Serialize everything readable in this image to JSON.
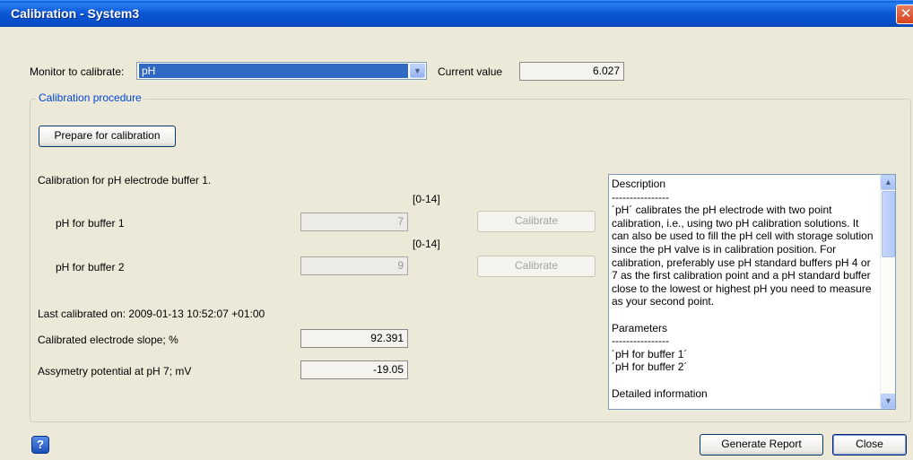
{
  "window": {
    "title": "Calibration - System3",
    "close_glyph": "✕"
  },
  "monitor": {
    "label": "Monitor to calibrate:",
    "selected": "pH",
    "current_value_label": "Current value",
    "current_value": "6.027"
  },
  "procedure": {
    "legend": "Calibration procedure",
    "prepare_label": "Prepare for calibration",
    "buffer_heading": "Calibration for pH  electrode buffer 1.",
    "buffers": [
      {
        "label": "pH for buffer 1",
        "value": "7",
        "range": "[0-14]",
        "calibrate_label": "Calibrate"
      },
      {
        "label": "pH for buffer 2",
        "value": "9",
        "range": "[0-14]",
        "calibrate_label": "Calibrate"
      }
    ],
    "last_calibrated": "Last calibrated on: 2009-01-13 10:52:07 +01:00",
    "slope_label": "Calibrated electrode slope; %",
    "slope_value": "92.391",
    "asym_label": "Assymetry potential at pH 7; mV",
    "asym_value": "-19.05"
  },
  "description": {
    "text": "Description\n----------------\n´pH´ calibrates the pH electrode with two point calibration, i.e., using two pH calibration solutions. It can also be used to fill the pH cell with storage solution since the pH valve is in calibration position. For calibration, preferably use pH standard buffers pH 4 or 7 as the first calibration point and a pH standard buffer close to the lowest or highest pH you need to measure as your second point.\n\nParameters\n----------------\n´pH for buffer 1´\n´pH for buffer 2´\n\nDetailed information"
  },
  "footer": {
    "help_glyph": "?",
    "generate_report_label": "Generate Report",
    "close_label": "Close"
  },
  "icons": {
    "dropdown": "chevron-down-icon",
    "scroll_up": "arrow-up-icon",
    "scroll_down": "arrow-down-icon",
    "help": "help-icon",
    "close": "close-icon"
  }
}
